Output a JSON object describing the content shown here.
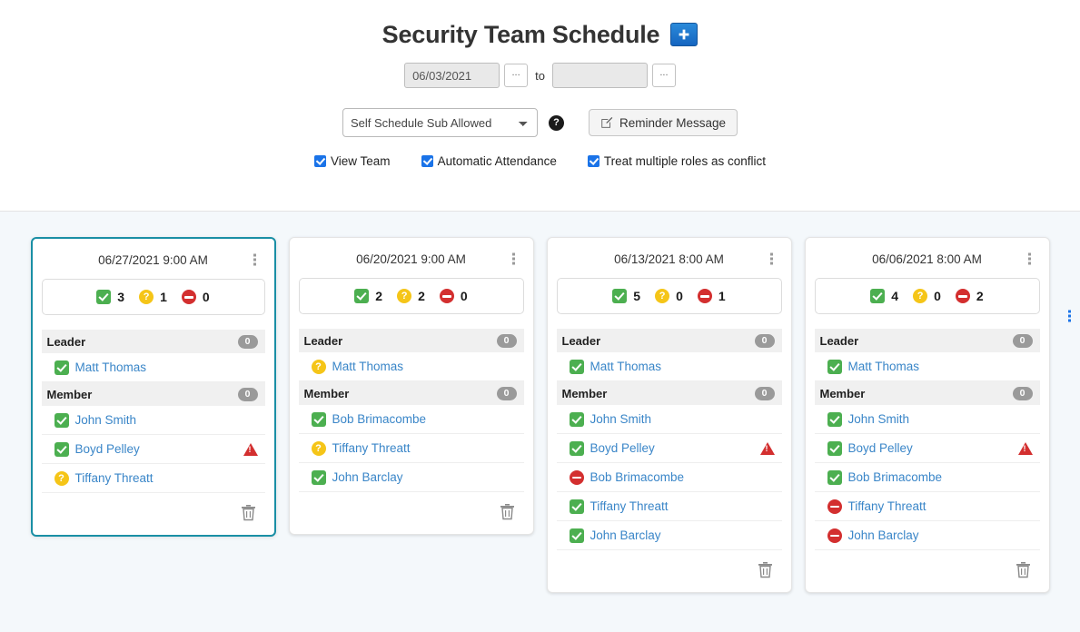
{
  "header": {
    "title": "Security Team Schedule",
    "add_button_label": "+",
    "date_from_value": "06/03/2021",
    "date_from_placeholder": "",
    "date_to_value": "",
    "date_to_placeholder": "",
    "date_picker_button_label": "...",
    "to_label": "to"
  },
  "controls": {
    "select_value": "Self Schedule Sub Allowed",
    "select_options": [
      "Self Schedule Sub Allowed"
    ],
    "help_icon_label": "?",
    "reminder_button_label": "Reminder Message",
    "checkboxes": [
      {
        "label": "View Team",
        "checked": true
      },
      {
        "label": "Automatic Attendance",
        "checked": true
      },
      {
        "label": "Treat multiple roles as conflict",
        "checked": true
      }
    ]
  },
  "icons": {
    "add": "plus-icon",
    "help": "help-circle-icon",
    "reminder": "edit-square-icon",
    "menu": "kebab-menu-icon",
    "delete": "trash-icon",
    "yes": "green-check-icon",
    "maybe": "yellow-question-icon",
    "no": "red-minus-circle-icon",
    "warning": "red-warning-triangle-icon"
  },
  "colors": {
    "accent_blue": "#1a73e8",
    "yes_green": "#4caf50",
    "maybe_yellow": "#f5c518",
    "no_red": "#d32f2f",
    "warning_red": "#d32f2f",
    "selected_border": "#1a8fa5",
    "link_blue": "#3a86c8",
    "page_bg": "#f4f8fb"
  },
  "cards": [
    {
      "date": "06/27/2021 9:00 AM",
      "selected": true,
      "tally": {
        "yes": "3",
        "maybe": "1",
        "no": "0"
      },
      "roles": [
        {
          "name": "Leader",
          "badge": "0",
          "people": [
            {
              "name": "Matt Thomas",
              "status": "yes",
              "warning": false
            }
          ]
        },
        {
          "name": "Member",
          "badge": "0",
          "people": [
            {
              "name": "John Smith",
              "status": "yes",
              "warning": false
            },
            {
              "name": "Boyd Pelley",
              "status": "yes",
              "warning": true
            },
            {
              "name": "Tiffany Threatt",
              "status": "maybe",
              "warning": false
            }
          ]
        }
      ]
    },
    {
      "date": "06/20/2021 9:00 AM",
      "selected": false,
      "tally": {
        "yes": "2",
        "maybe": "2",
        "no": "0"
      },
      "roles": [
        {
          "name": "Leader",
          "badge": "0",
          "people": [
            {
              "name": "Matt Thomas",
              "status": "maybe",
              "warning": false
            }
          ]
        },
        {
          "name": "Member",
          "badge": "0",
          "people": [
            {
              "name": "Bob Brimacombe",
              "status": "yes",
              "warning": false
            },
            {
              "name": "Tiffany Threatt",
              "status": "maybe",
              "warning": false
            },
            {
              "name": "John Barclay",
              "status": "yes",
              "warning": false
            }
          ]
        }
      ]
    },
    {
      "date": "06/13/2021 8:00 AM",
      "selected": false,
      "tally": {
        "yes": "5",
        "maybe": "0",
        "no": "1"
      },
      "roles": [
        {
          "name": "Leader",
          "badge": "0",
          "people": [
            {
              "name": "Matt Thomas",
              "status": "yes",
              "warning": false
            }
          ]
        },
        {
          "name": "Member",
          "badge": "0",
          "people": [
            {
              "name": "John Smith",
              "status": "yes",
              "warning": false
            },
            {
              "name": "Boyd Pelley",
              "status": "yes",
              "warning": true
            },
            {
              "name": "Bob Brimacombe",
              "status": "no",
              "warning": false
            },
            {
              "name": "Tiffany Threatt",
              "status": "yes",
              "warning": false
            },
            {
              "name": "John Barclay",
              "status": "yes",
              "warning": false
            }
          ]
        }
      ]
    },
    {
      "date": "06/06/2021 8:00 AM",
      "selected": false,
      "tally": {
        "yes": "4",
        "maybe": "0",
        "no": "2"
      },
      "roles": [
        {
          "name": "Leader",
          "badge": "0",
          "people": [
            {
              "name": "Matt Thomas",
              "status": "yes",
              "warning": false
            }
          ]
        },
        {
          "name": "Member",
          "badge": "0",
          "people": [
            {
              "name": "John Smith",
              "status": "yes",
              "warning": false
            },
            {
              "name": "Boyd Pelley",
              "status": "yes",
              "warning": true
            },
            {
              "name": "Bob Brimacombe",
              "status": "yes",
              "warning": false
            },
            {
              "name": "Tiffany Threatt",
              "status": "no",
              "warning": false
            },
            {
              "name": "John Barclay",
              "status": "no",
              "warning": false
            }
          ]
        }
      ]
    }
  ]
}
